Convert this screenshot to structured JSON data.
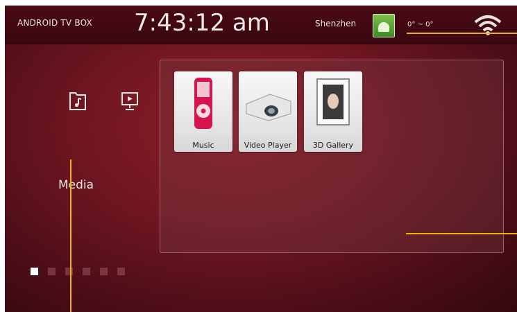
{
  "topbar": {
    "brand": "ANDROID TV BOX",
    "time": "7:43:12 am",
    "city": "Shenzhen",
    "temperature": "0° ~ 0°",
    "weather_icon": "weather-icon",
    "signal_icon": "wifi-icon"
  },
  "categories": [
    {
      "name": "music-folder-icon"
    },
    {
      "name": "video-screen-icon"
    }
  ],
  "media_label": "Media",
  "apps": [
    {
      "label": "Music",
      "icon": "music-player-icon"
    },
    {
      "label": "Video Player",
      "icon": "projector-icon"
    },
    {
      "label": "3D Gallery",
      "icon": "photo-frame-icon"
    }
  ],
  "pager": {
    "pages": 6,
    "active": 1
  },
  "colors": {
    "accent_line": "#f2b600",
    "background": "#6e1621"
  }
}
